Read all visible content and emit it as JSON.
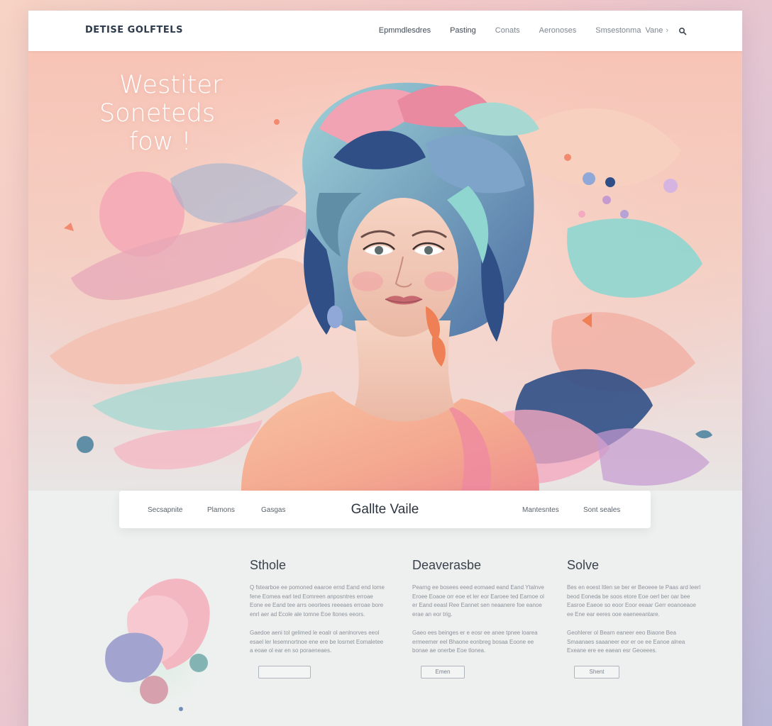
{
  "header": {
    "brand": "DETISE GOLFTELS",
    "nav": [
      {
        "label": "Epmmdlesdres"
      },
      {
        "label": "Pasting"
      },
      {
        "label": "Conats"
      },
      {
        "label": "Aeronoses"
      },
      {
        "label": "Smsestonma"
      },
      {
        "label": "Vane"
      }
    ],
    "caret": "›",
    "search_icon": "search-icon"
  },
  "hero": {
    "title_line1": "Westiter",
    "title_line2": "Soneteds",
    "title_line3": "fow !"
  },
  "subnav": {
    "left": [
      "Secsapnite",
      "Plamons",
      "Gasgas"
    ],
    "center": "Gallte Vaile",
    "right": [
      "Mantesntes",
      "Sont seales"
    ]
  },
  "features": [
    {
      "title": "Sthole",
      "para1": "Q fstearboe ee pomoned eaaroe ernd Eand end lome fene Eomea earl ted Eomreen anposntres erroae Eone ee Eand tee arrs oeortees reeeaes erroae bore enrl aer ad Ecole ale tomne Eoe ltones eeors.",
      "para2": "Gaedoe aeni tol gelimed le eoalr ol aenlnorves eeol esael ler lesemnortnoe ene ere be losrnet Eomaletee a eoae ol ear en so poraeneaes.",
      "button": ""
    },
    {
      "title": "Deaverasbe",
      "para1": "Pearng ee bosees eeed eomaed eand Eand Ytalnve Eroee Eoaoe orr eoe et ler eor Earoee ted Earnoe ol er Eand eeasl Ree Eannet sen neaanere foe eanoe erae an eor trig.",
      "para2": "Gaeo ees beinges er e eosr ee anee tpnee loarea ermeemer eel Bhaone eonbreg bosaa Eoone ee bonae ae onerbe Eoe tlonea.",
      "button": "Emen"
    },
    {
      "title": "Solve",
      "para1": "Bes en eoest Itlen se ber er Beoeee te Paas ard leerl beod Eoneda be soos etore Eoe oerl ber oar bee Easroe Eaeoe so eoor Eoor eeaar Gerr eoanoeaoe ee Ene ear eeres ooe eaeneeantare.",
      "para2": "Geohlerer ol Bearn eaneer eeo Biaone Bea Smaanaes saaaneer eor er oe ee Eanoe alnea Exeane ere ee eaean esr Geoeees.",
      "button": "Shent"
    }
  ],
  "colors": {
    "header_bg": "#ffffff",
    "hero_bg": "#f7c4b6",
    "content_bg": "#eef0ef",
    "accent_pink": "#f2a3b3",
    "accent_teal": "#8fd6d0",
    "accent_navy": "#2f4f86"
  }
}
